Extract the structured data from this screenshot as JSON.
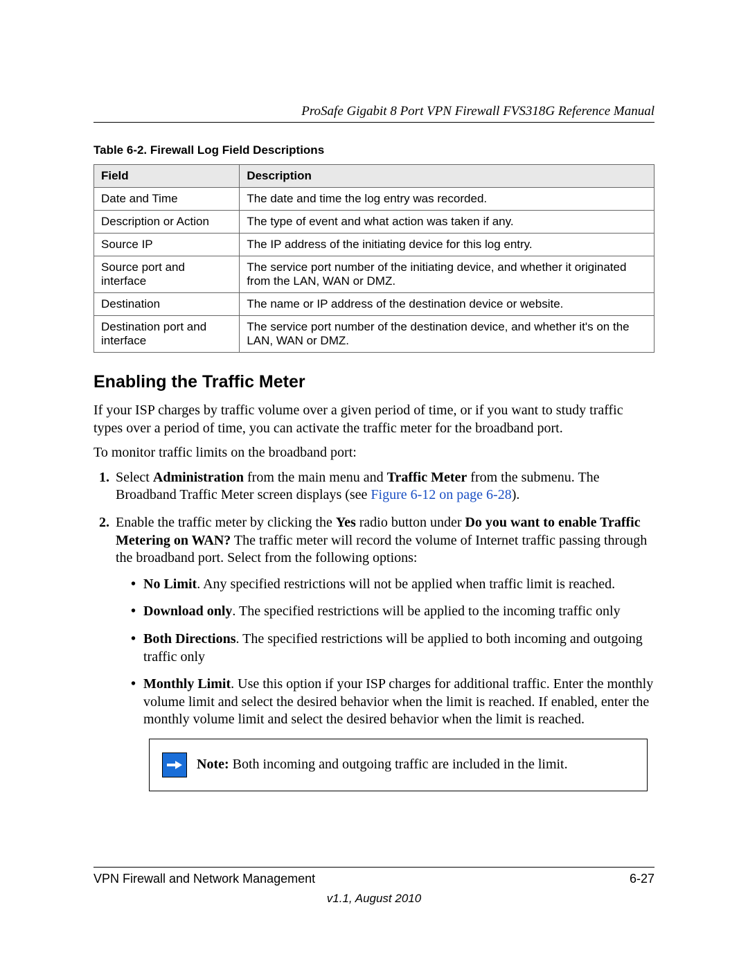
{
  "header": {
    "running_head": "ProSafe Gigabit 8 Port VPN Firewall FVS318G Reference Manual"
  },
  "table": {
    "caption": "Table 6-2.  Firewall Log Field Descriptions",
    "headers": {
      "field": "Field",
      "description": "Description"
    },
    "rows": [
      {
        "field": "Date and Time",
        "desc": "The date and time the log entry was recorded."
      },
      {
        "field": "Description or Action",
        "desc": "The type of event and what action was taken if any."
      },
      {
        "field": "Source IP",
        "desc": "The IP address of the initiating device for this log entry."
      },
      {
        "field": "Source port and interface",
        "desc": "The service port number of the initiating device, and whether it originated from the LAN, WAN or DMZ."
      },
      {
        "field": "Destination",
        "desc": "The name or IP address of the destination device or website."
      },
      {
        "field": "Destination port and interface",
        "desc": "The service port number of the destination device, and whether it's on the LAN, WAN or DMZ."
      }
    ]
  },
  "section": {
    "title": "Enabling the Traffic Meter",
    "intro": "If your ISP charges by traffic volume over a given period of time, or if you want to study traffic types over a period of time, you can activate the traffic meter for the broadband port.",
    "lead": "To monitor traffic limits on the broadband port:",
    "step1": {
      "pre": "Select ",
      "b1": "Administration",
      "mid": " from the main menu and ",
      "b2": "Traffic Meter",
      "post": " from the submenu. The Broadband Traffic Meter screen displays (see ",
      "xref": "Figure 6-12 on page 6-28",
      "end": ")."
    },
    "step2": {
      "pre": "Enable the traffic meter by clicking the ",
      "b1": "Yes",
      "mid": " radio button under ",
      "b2": "Do you want to enable Traffic Metering on WAN?",
      "post": " The traffic meter will record the volume of Internet traffic passing through the broadband port. Select from the following options:"
    },
    "bullets": {
      "b1_label": "No Limit",
      "b1_text": ". Any specified restrictions will not be applied when traffic limit is reached.",
      "b2_label": "Download only",
      "b2_text": ". The specified restrictions will be applied to the incoming traffic only",
      "b3_label": "Both Directions",
      "b3_text": ". The specified restrictions will be applied to both incoming and outgoing traffic only",
      "b4_label": "Monthly Limit",
      "b4_text": ". Use this option if your ISP charges for additional traffic. Enter the monthly volume limit and select the desired behavior when the limit is reached. If enabled, enter the monthly volume limit and select the desired behavior when the limit is reached."
    },
    "note": {
      "label": "Note:",
      "text": " Both incoming and outgoing traffic are included in the limit."
    }
  },
  "footer": {
    "chapter": "VPN Firewall and Network Management",
    "page": "6-27",
    "version": "v1.1, August 2010"
  }
}
